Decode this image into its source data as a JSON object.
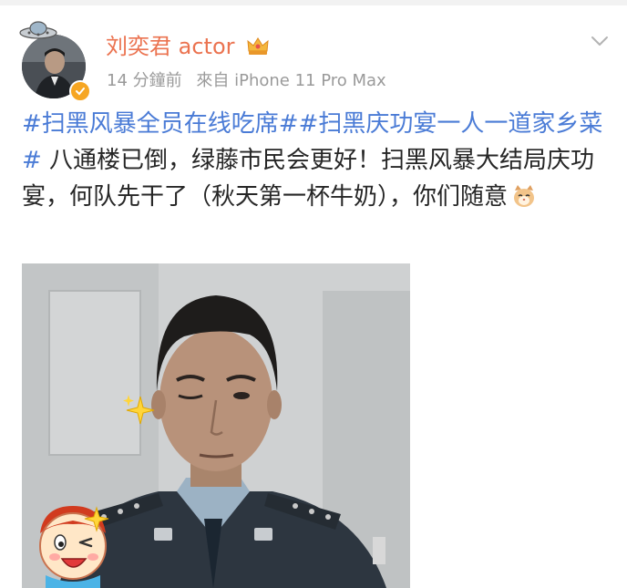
{
  "post": {
    "username": "刘奕君 actor",
    "time": "14 分鐘前",
    "source": "來自 iPhone 11 Pro Max",
    "content": {
      "hashtag1": "#扫黑风暴全员在线吃席#",
      "hashtag2": "#扫黑庆功宴一人一道家乡菜#",
      "text": " 八通楼已倒，绿藤市民会更好！扫黑风暴大结局庆功宴，何队先干了（秋天第一杯牛奶），你们随意"
    }
  },
  "icons": {
    "crown": "crown-icon",
    "chevron": "chevron-down-icon",
    "verified": "verified-badge-icon",
    "cat_emoji": "cat-emoji-icon",
    "sparkle": "sparkle-sticker-icon",
    "wink": "wink-face-sticker-icon"
  },
  "colors": {
    "username": "#eb7350",
    "hashtag": "#4a7bd6",
    "meta": "#9a9a9a",
    "text": "#262626"
  }
}
